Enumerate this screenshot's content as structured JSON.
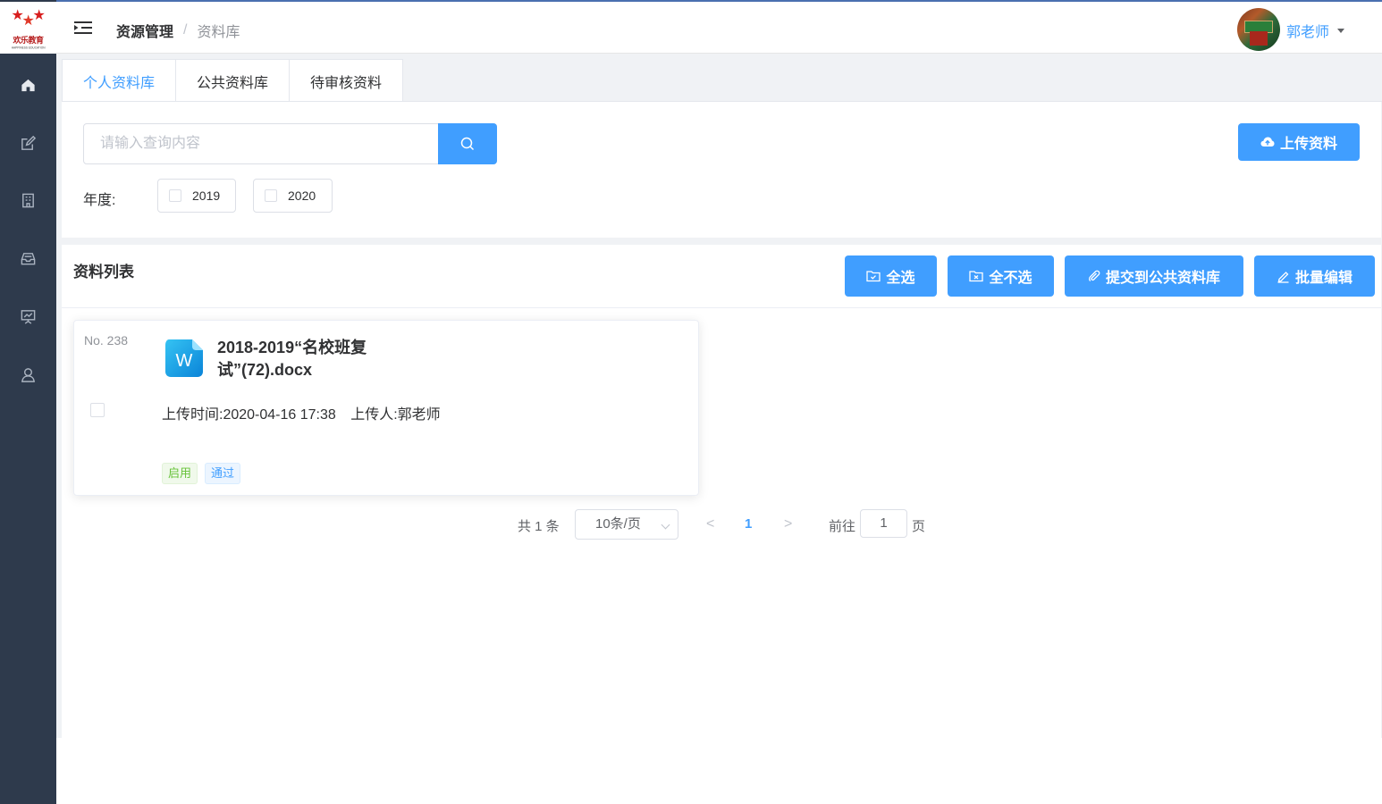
{
  "logo": {
    "name": "欢乐教育",
    "sub": "HAPPINESS EDUCATION"
  },
  "sidebar": {
    "items": [
      {
        "icon": "home-icon"
      },
      {
        "icon": "edit-icon"
      },
      {
        "icon": "building-icon"
      },
      {
        "icon": "inbox-icon"
      },
      {
        "icon": "presentation-icon"
      },
      {
        "icon": "user-icon"
      }
    ]
  },
  "header": {
    "breadcrumb": [
      "资源管理",
      "资料库"
    ],
    "separator": "/",
    "user": "郭老师"
  },
  "tabs": [
    {
      "label": "个人资料库",
      "active": true
    },
    {
      "label": "公共资料库",
      "active": false
    },
    {
      "label": "待审核资料",
      "active": false
    }
  ],
  "search": {
    "placeholder": "请输入查询内容",
    "value": "",
    "upload_label": "上传资料"
  },
  "filter": {
    "year_label": "年度:",
    "years": [
      {
        "label": "2019",
        "checked": false
      },
      {
        "label": "2020",
        "checked": false
      }
    ]
  },
  "list": {
    "title": "资料列表",
    "actions": {
      "select_all": "全选",
      "deselect_all": "全不选",
      "submit_public": "提交到公共资料库",
      "batch_edit": "批量编辑"
    },
    "items": [
      {
        "no": "No. 238",
        "title": "2018-2019“名校班复试”(72).docx",
        "upload_time": "上传时间:2020-04-16 17:38",
        "uploader": "上传人:郭老师",
        "tags": [
          "启用",
          "通过"
        ],
        "file_icon": "word-doc-icon",
        "icon_letter": "W"
      }
    ]
  },
  "pagination": {
    "total": "共 1 条",
    "page_size": "10条/页",
    "prev": "<",
    "current": "1",
    "next": ">",
    "goto_label": "前往",
    "goto_value": "1",
    "page_unit": "页"
  },
  "colors": {
    "primary": "#409eff",
    "sidebar": "#2e3a4c",
    "success": "#67c23a",
    "brand_red": "#d81e1e"
  }
}
